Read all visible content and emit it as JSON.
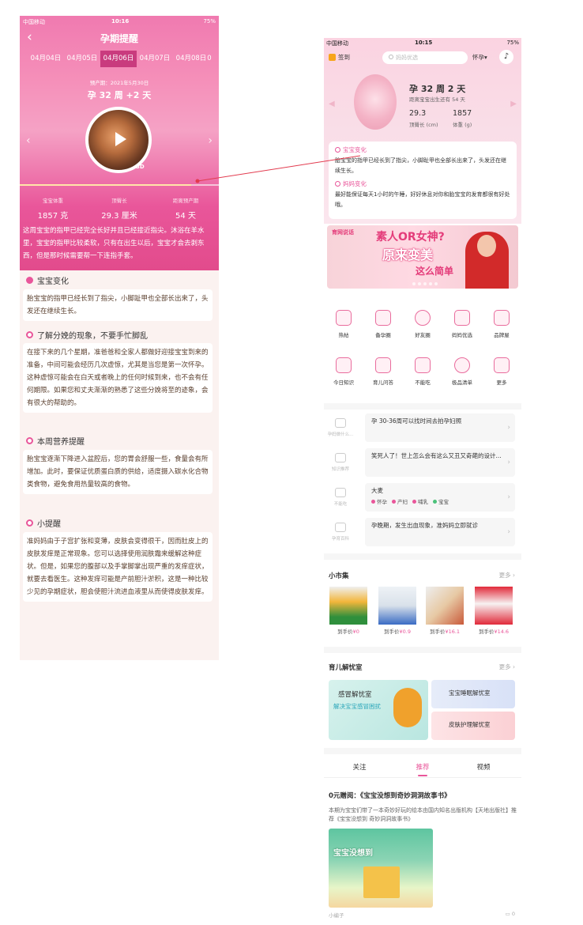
{
  "left": {
    "status": {
      "carrier": "中国移动",
      "time": "10:16",
      "battery": "75%"
    },
    "title": "孕期提醒",
    "dates": [
      "日",
      "04月04日",
      "04月05日",
      "04月06日",
      "04月07日",
      "04月08日",
      "0"
    ],
    "active_date_index": 3,
    "due_date": "预产期：2021年5月30日",
    "week": "孕 32 周 +2 天",
    "badge_3d": "3D",
    "progress_fraction": 0.86,
    "stats": [
      {
        "label": "宝宝体重",
        "value": "1857 克"
      },
      {
        "label": "顶臀长",
        "value": "29.3 厘米"
      },
      {
        "label": "距离预产期",
        "value": "54 天"
      }
    ],
    "intro": "这周宝宝的指甲已经完全长好并且已经接近指尖。沐浴在羊水里，宝宝的指甲比较柔软，只有在出生以后，宝宝才会去剥东西，但是那时候需要帮一下连指手套。",
    "sections": [
      {
        "title": "宝宝变化",
        "body": "胎宝宝的指甲已经长到了指尖，小脚趾甲也全部长出来了，头发还在继续生长。"
      },
      {
        "title": "了解分娩的现象，不要手忙脚乱",
        "body": "在接下来的几个星期，准爸爸和全家人都做好迎接宝宝到来的准备，中间可能会经历几次虚惊，尤其是当您是第一次怀孕。这种虚惊可能会在白天或者晚上的任何时候到来，也不会有任何期限。如果您和丈夫渐渐的熟悉了这些分娩将至的迹象，会有很大的帮助的。"
      },
      {
        "title": "本周营养提醒",
        "body": "胎宝宝逐渐下降进入盆腔后，您的胃会舒服一些，食量会有所增加。此时，要保证优质蛋白质的供给，适度摄入碳水化合物类食物，避免食用热量较高的食物。"
      },
      {
        "title": "小提醒",
        "body": "准妈妈由于子宫扩张和变薄，皮肤会变得很干，因而肚皮上的皮肤发痒是正常现象。您可以选择使用润肤霜来缓解这种症状。但是，如果您的腹部以及手掌脚掌出现严重的发痒症状，就要去看医生。这种发痒可能是产前胆汁淤积，这是一种比较少见的孕期症状，胆会使胆汁流进血液里从而使得皮肤发痒。"
      }
    ]
  },
  "right": {
    "status": {
      "carrier": "中国移动",
      "time": "10:15",
      "battery": "75%"
    },
    "header": {
      "signin": "签到",
      "search_placeholder": "妈妈优选",
      "stage": "怀孕▾"
    },
    "week": "孕 32 周 2 天",
    "sub": "距离宝宝出生还有 54 天",
    "metrics": [
      {
        "value": "29.3",
        "label": "顶臀长 (cm)"
      },
      {
        "value": "1857",
        "label": "体重 (g)"
      }
    ],
    "baby_change": {
      "title": "宝宝变化",
      "body": "胎宝宝的指甲已经长到了指尖，小脚趾甲也全部长出来了，头发还在继续生长。"
    },
    "mom_change": {
      "title": "妈妈变化",
      "body": "最好能保证每天1小时的午睡，好好休息对你和胎宝宝的发育都很有好处哦。"
    },
    "banner": {
      "logo": "育网说话",
      "line1": "素人OR女神?",
      "line2": "原来变美",
      "line3": "这么简单"
    },
    "grid": [
      "热帖",
      "备孕圈",
      "好友圈",
      "妈妈优选",
      "品牌屋",
      "今日知识",
      "育儿问答",
      "不能吃",
      "极品清单",
      "更多"
    ],
    "tips": [
      {
        "cat": "孕妈做什么...",
        "text": "孕 30-36周可以找时间去拍孕妇照"
      },
      {
        "cat": "知识推荐",
        "text": "笑死人了！世上怎么会有这么又丑又奇葩的设计..."
      },
      {
        "cat": "不能吃",
        "text": "大麦",
        "tags": [
          "怀孕",
          "产妇",
          "哺乳",
          "宝宝"
        ]
      },
      {
        "cat": "孕育百科",
        "text": "孕晚期，发生出血现象，准妈妈立即就诊"
      }
    ],
    "market": {
      "title": "小市集",
      "more": "更多",
      "items": [
        {
          "label": "到手价",
          "price": "¥0"
        },
        {
          "label": "到手价",
          "price": "¥0.9"
        },
        {
          "label": "到手价",
          "price": "¥16.1"
        },
        {
          "label": "到手价",
          "price": "¥14.6"
        }
      ]
    },
    "worry": {
      "title": "育儿解忧室",
      "more": "更多",
      "big_title": "感冒解忧室",
      "big_sub": "解决宝宝感冒困扰",
      "small": [
        "宝宝睡眠解忧室",
        "皮肤护理解忧室"
      ]
    },
    "tabs": [
      "关注",
      "推荐",
      "视频"
    ],
    "active_tab": 1,
    "article": {
      "title": "0元赠阅：《宝宝没想到奇妙洞洞故事书》",
      "summary": "本期为宝宝们带了一本奇妙好玩的绘本由国内知名出版机构【天地出版社】推荐《宝宝没想到 奇妙洞洞故事书》",
      "cover_text": "宝宝没想到",
      "author": "小编子",
      "comments": "0"
    },
    "colors": {
      "accent": "#e9569a",
      "hero": "#e24b8c"
    }
  }
}
